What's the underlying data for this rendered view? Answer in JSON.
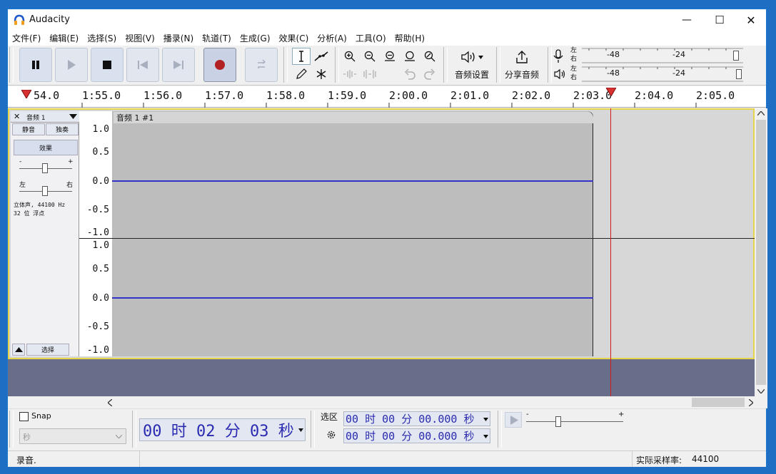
{
  "window": {
    "title": "Audacity",
    "minimize": "—",
    "maximize": "☐",
    "close": "✕"
  },
  "menu": [
    "文件(F)",
    "编辑(E)",
    "选择(S)",
    "视图(V)",
    "播录(N)",
    "轨道(T)",
    "生成(G)",
    "效果(C)",
    "分析(A)",
    "工具(O)",
    "帮助(H)"
  ],
  "toolbar": {
    "audio_setup_label": "音频设置",
    "share_audio_label": "分享音频",
    "record_meter": {
      "left": "左",
      "right": "右",
      "marks": [
        "-48",
        "-24"
      ]
    },
    "play_meter": {
      "left": "左",
      "right": "右",
      "marks": [
        "-48",
        "-24"
      ]
    }
  },
  "timeline": {
    "labels": [
      "54.0",
      "1:55.0",
      "1:56.0",
      "1:57.0",
      "1:58.0",
      "1:59.0",
      "2:00.0",
      "2:01.0",
      "2:02.0",
      "2:03.0",
      "2:04.0",
      "2:05.0"
    ]
  },
  "track": {
    "name": "音频 1",
    "mute": "静音",
    "solo": "独奏",
    "effects": "效果",
    "pan_left": "左",
    "pan_right": "右",
    "gain_minus": "-",
    "gain_plus": "+",
    "info_line1": "立体声, 44100 Hz",
    "info_line2": "32 位 浮点",
    "select": "选择",
    "clip_name": "音频 1 #1",
    "scale": [
      "1.0",
      "0.5",
      "0.0",
      "-0.5",
      "-1.0"
    ]
  },
  "bottom": {
    "snap_label": "Snap",
    "snap_unit": "秒",
    "time_display": "00 时 02 分 03 秒",
    "selection_label": "选区",
    "sel_start": "00 时 00 分 00.000 秒",
    "sel_end": "00 时 00 分 00.000 秒",
    "speed_minus": "-",
    "speed_plus": "+"
  },
  "status": {
    "text": "录音.",
    "rate_label": "实际采样率:",
    "rate_value": "44100"
  },
  "colors": {
    "accent": "#3232c8",
    "cursor": "#d01c1c",
    "selection_border": "#e6d54b",
    "record": "#b32222"
  }
}
